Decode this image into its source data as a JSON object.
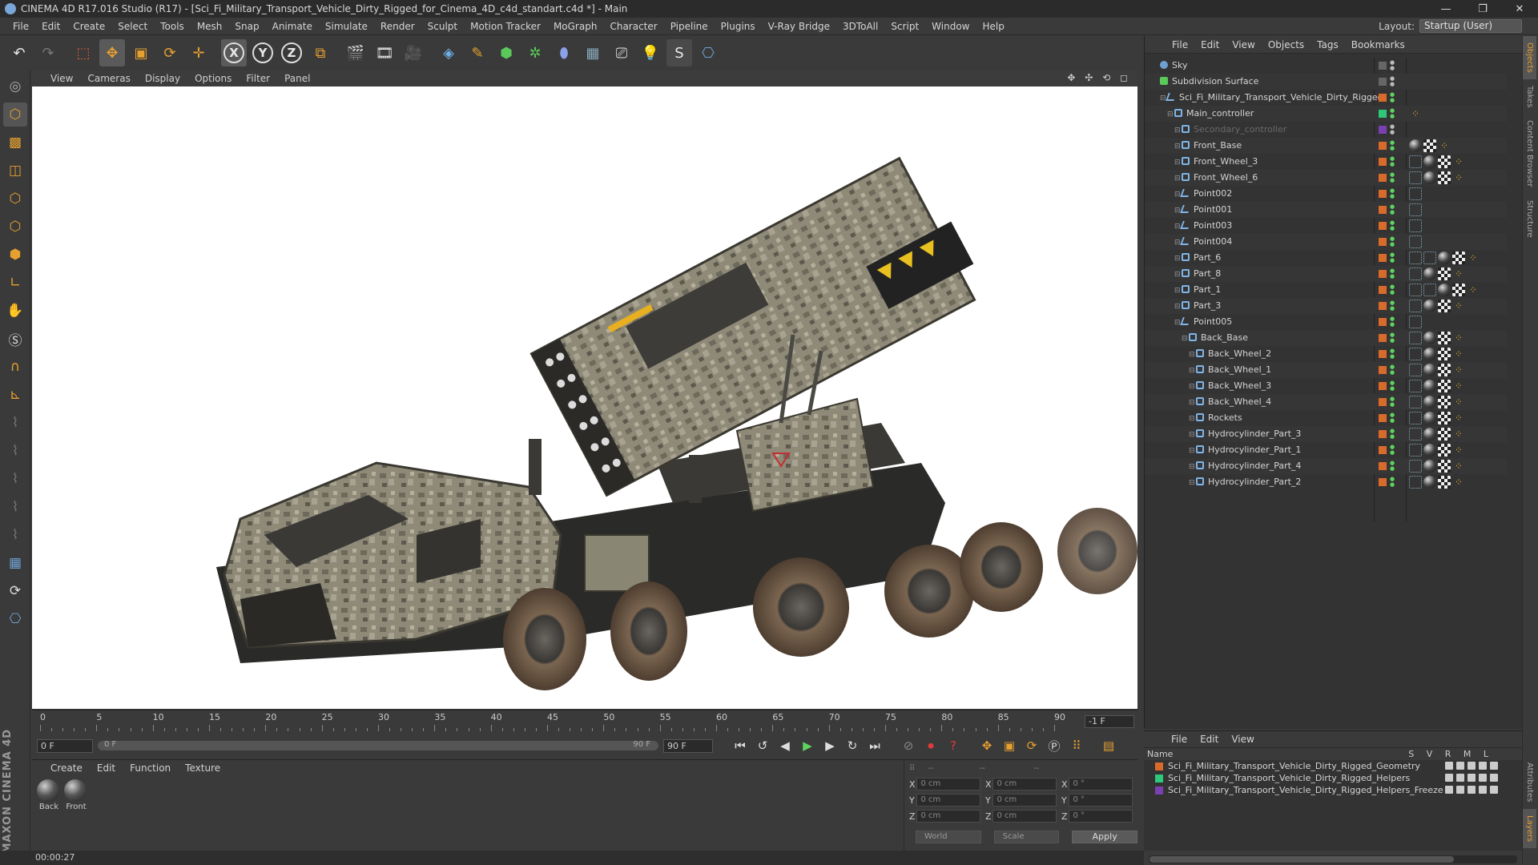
{
  "window": {
    "title": "CINEMA 4D R17.016 Studio (R17) - [Sci_Fi_Military_Transport_Vehicle_Dirty_Rigged_for_Cinema_4D_c4d_standart.c4d *] - Main",
    "min": "—",
    "max": "❐",
    "close": "✕"
  },
  "menu": [
    "File",
    "Edit",
    "Create",
    "Select",
    "Tools",
    "Mesh",
    "Snap",
    "Animate",
    "Simulate",
    "Render",
    "Sculpt",
    "Motion Tracker",
    "MoGraph",
    "Character",
    "Pipeline",
    "Plugins",
    "V-Ray Bridge",
    "3DToAll",
    "Script",
    "Window",
    "Help"
  ],
  "layout": {
    "label": "Layout:",
    "value": "Startup (User)"
  },
  "viewport_menu": [
    "View",
    "Cameras",
    "Display",
    "Options",
    "Filter",
    "Panel"
  ],
  "viewport_icons": "✥ ✣ ⟲ ◻",
  "timeline": {
    "ticks": [
      "0",
      "5",
      "10",
      "15",
      "20",
      "25",
      "30",
      "35",
      "40",
      "45",
      "50",
      "55",
      "60",
      "65",
      "70",
      "75",
      "80",
      "85",
      "90"
    ],
    "end_frame": "-1 F"
  },
  "transport": {
    "current_frame": "0 F",
    "slider_start": "0 F",
    "slider_end": "90 F",
    "max_frame": "90 F"
  },
  "material_menu": [
    "Create",
    "Edit",
    "Function",
    "Texture"
  ],
  "materials": [
    "Back",
    "Front"
  ],
  "coords": {
    "rows": [
      {
        "a": "X",
        "av": "0 cm",
        "b": "X",
        "bv": "0 cm",
        "c": "X",
        "cv": "0 °"
      },
      {
        "a": "Y",
        "av": "0 cm",
        "b": "Y",
        "bv": "0 cm",
        "c": "Y",
        "cv": "0 °"
      },
      {
        "a": "Z",
        "av": "0 cm",
        "b": "Z",
        "bv": "0 cm",
        "c": "Z",
        "cv": "0 °"
      }
    ],
    "world": "World",
    "scale": "Scale",
    "apply": "Apply"
  },
  "status": {
    "time": "00:00:27"
  },
  "object_menu": [
    "File",
    "Edit",
    "View",
    "Objects",
    "Tags",
    "Bookmarks"
  ],
  "objects": [
    {
      "name": "Sky",
      "indent": 0,
      "icon": "sphere",
      "col": "grey",
      "tags": []
    },
    {
      "name": "Subdivision Surface",
      "indent": 0,
      "icon": "subd",
      "col": "grey",
      "tags": []
    },
    {
      "name": "Sci_Fi_Military_Transport_Vehicle_Dirty_Rigged",
      "indent": 1,
      "icon": "bone",
      "col": "orange",
      "tags": []
    },
    {
      "name": "Main_controller",
      "indent": 2,
      "icon": "null",
      "col": "green",
      "tags": [
        "orng"
      ]
    },
    {
      "name": "Secondary_controller",
      "indent": 3,
      "icon": "null",
      "col": "purple",
      "tags": [],
      "dim": true
    },
    {
      "name": "Front_Base",
      "indent": 3,
      "icon": "null",
      "col": "orange",
      "tags": [
        "mat",
        "chk",
        "orng"
      ]
    },
    {
      "name": "Front_Wheel_3",
      "indent": 3,
      "icon": "null",
      "col": "orange",
      "tags": [
        "ik",
        "mat",
        "chk",
        "orng"
      ]
    },
    {
      "name": "Front_Wheel_6",
      "indent": 3,
      "icon": "null",
      "col": "orange",
      "tags": [
        "ik",
        "mat",
        "chk",
        "orng"
      ]
    },
    {
      "name": "Point002",
      "indent": 3,
      "icon": "bone",
      "col": "orange",
      "tags": [
        "ik"
      ]
    },
    {
      "name": "Point001",
      "indent": 3,
      "icon": "bone",
      "col": "orange",
      "tags": [
        "ik"
      ]
    },
    {
      "name": "Point003",
      "indent": 3,
      "icon": "bone",
      "col": "orange",
      "tags": [
        "ik"
      ]
    },
    {
      "name": "Point004",
      "indent": 3,
      "icon": "bone",
      "col": "orange",
      "tags": [
        "ik"
      ]
    },
    {
      "name": "Part_6",
      "indent": 3,
      "icon": "null",
      "col": "orange",
      "tags": [
        "ik",
        "ik",
        "mat",
        "chk",
        "orng"
      ]
    },
    {
      "name": "Part_8",
      "indent": 3,
      "icon": "null",
      "col": "orange",
      "tags": [
        "ik",
        "mat",
        "chk",
        "orng"
      ]
    },
    {
      "name": "Part_1",
      "indent": 3,
      "icon": "null",
      "col": "orange",
      "tags": [
        "ik",
        "ik",
        "mat",
        "chk",
        "orng"
      ]
    },
    {
      "name": "Part_3",
      "indent": 3,
      "icon": "null",
      "col": "orange",
      "tags": [
        "ik",
        "mat",
        "chk",
        "orng"
      ]
    },
    {
      "name": "Point005",
      "indent": 3,
      "icon": "bone",
      "col": "orange",
      "tags": [
        "ik"
      ]
    },
    {
      "name": "Back_Base",
      "indent": 4,
      "icon": "null",
      "col": "orange",
      "tags": [
        "ik",
        "mat",
        "chk",
        "orng"
      ]
    },
    {
      "name": "Back_Wheel_2",
      "indent": 5,
      "icon": "null",
      "col": "orange",
      "tags": [
        "ik",
        "mat",
        "chk",
        "orng"
      ]
    },
    {
      "name": "Back_Wheel_1",
      "indent": 5,
      "icon": "null",
      "col": "orange",
      "tags": [
        "ik",
        "mat",
        "chk",
        "orng"
      ]
    },
    {
      "name": "Back_Wheel_3",
      "indent": 5,
      "icon": "null",
      "col": "orange",
      "tags": [
        "ik",
        "mat",
        "chk",
        "orng"
      ]
    },
    {
      "name": "Back_Wheel_4",
      "indent": 5,
      "icon": "null",
      "col": "orange",
      "tags": [
        "ik",
        "mat",
        "chk",
        "orng"
      ]
    },
    {
      "name": "Rockets",
      "indent": 5,
      "icon": "null",
      "col": "orange",
      "tags": [
        "ik",
        "mat",
        "chk",
        "orng"
      ]
    },
    {
      "name": "Hydrocylinder_Part_3",
      "indent": 5,
      "icon": "null",
      "col": "orange",
      "tags": [
        "ik",
        "mat",
        "chk",
        "orng"
      ]
    },
    {
      "name": "Hydrocylinder_Part_1",
      "indent": 5,
      "icon": "null",
      "col": "orange",
      "tags": [
        "ik",
        "mat",
        "chk",
        "orng"
      ]
    },
    {
      "name": "Hydrocylinder_Part_4",
      "indent": 5,
      "icon": "null",
      "col": "orange",
      "tags": [
        "ik",
        "mat",
        "chk",
        "orng"
      ]
    },
    {
      "name": "Hydrocylinder_Part_2",
      "indent": 5,
      "icon": "null",
      "col": "orange",
      "tags": [
        "ik",
        "mat",
        "chk",
        "orng"
      ]
    }
  ],
  "layer_menu": [
    "File",
    "Edit",
    "View"
  ],
  "layer_header": {
    "name": "Name",
    "cols": "S V R M L"
  },
  "layers": [
    {
      "name": "Sci_Fi_Military_Transport_Vehicle_Dirty_Rigged_Geometry",
      "color": "#d86a2a"
    },
    {
      "name": "Sci_Fi_Military_Transport_Vehicle_Dirty_Rigged_Helpers",
      "color": "#2ec87a"
    },
    {
      "name": "Sci_Fi_Military_Transport_Vehicle_Dirty_Rigged_Helpers_Freeze",
      "color": "#7a40b0"
    }
  ],
  "side_tabs": [
    "Objects",
    "Takes",
    "Content Browser",
    "Structure"
  ],
  "side_tabs_bottom": [
    "Attributes",
    "Layers"
  ],
  "colors": {
    "accent": "#e6a030",
    "orange_layer": "#d86a2a",
    "green_layer": "#2ec87a",
    "purple_layer": "#7a40b0"
  }
}
